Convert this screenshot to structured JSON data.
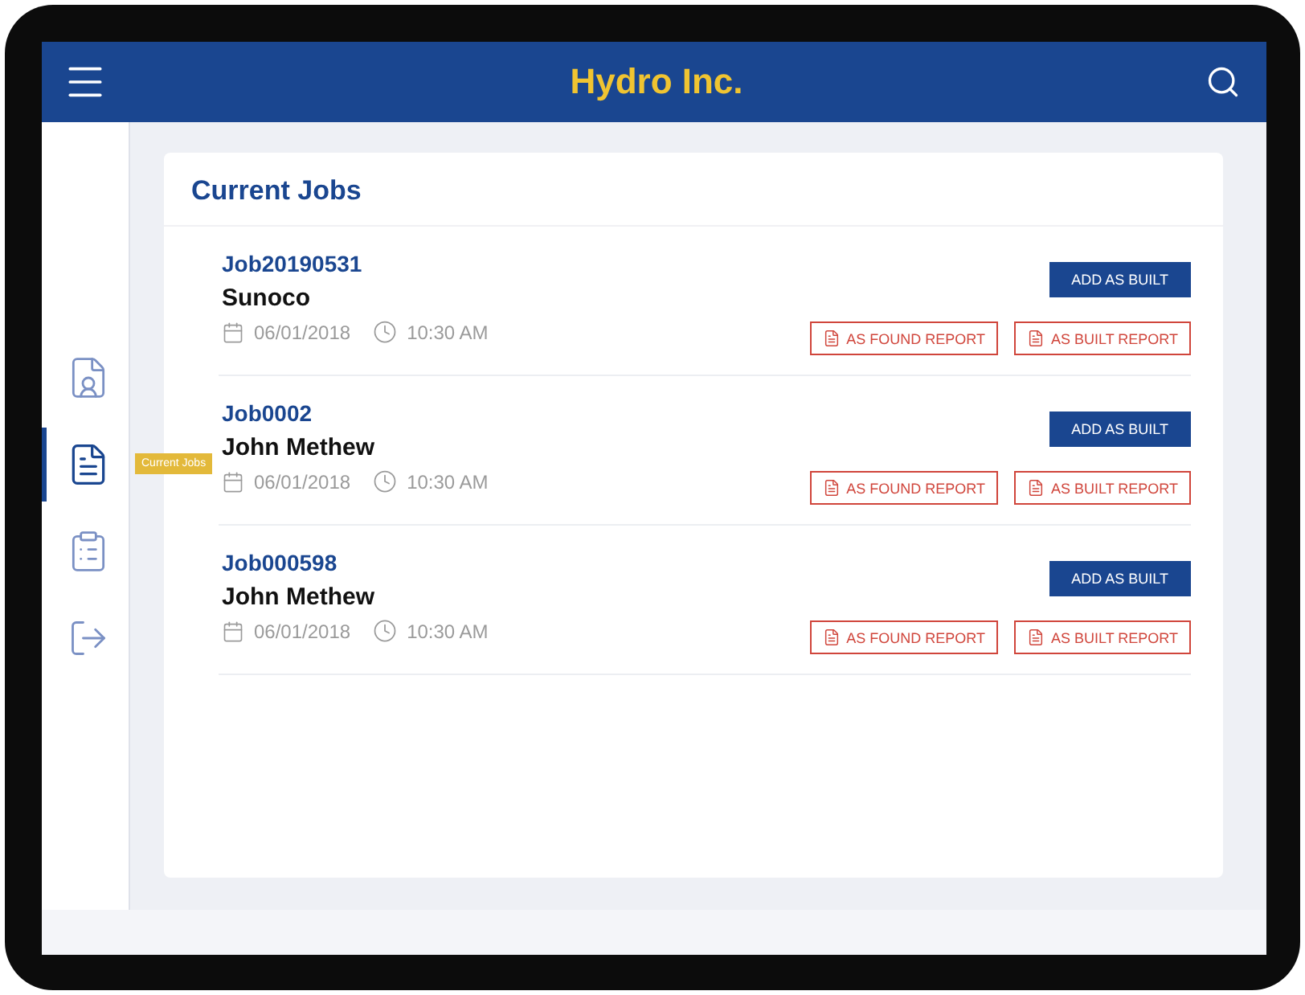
{
  "header": {
    "title": "Hydro Inc."
  },
  "sidebar": {
    "items": [
      {
        "kind": "profile",
        "selected": false
      },
      {
        "kind": "jobs",
        "selected": true,
        "tooltip": "Current Jobs"
      },
      {
        "kind": "checklist",
        "selected": false
      },
      {
        "kind": "logout",
        "selected": false
      }
    ]
  },
  "card": {
    "title": "Current Jobs",
    "jobs": [
      {
        "id": "Job20190531",
        "name": "Sunoco",
        "date": "06/01/2018",
        "time": "10:30 AM",
        "buttons": [
          "ADD AS BUILT",
          "AS FOUND REPORT",
          "AS BUILT REPORT"
        ]
      },
      {
        "id": "Job0002",
        "name": "John Methew",
        "date": "06/01/2018",
        "time": "10:30 AM",
        "buttons": [
          "ADD AS BUILT",
          "AS FOUND REPORT",
          "AS BUILT REPORT"
        ]
      },
      {
        "id": "Job000598",
        "name": "John Methew",
        "date": "06/01/2018",
        "time": "10:30 AM",
        "buttons": [
          "ADD AS BUILT",
          "AS FOUND REPORT",
          "AS BUILT REPORT"
        ]
      }
    ]
  }
}
